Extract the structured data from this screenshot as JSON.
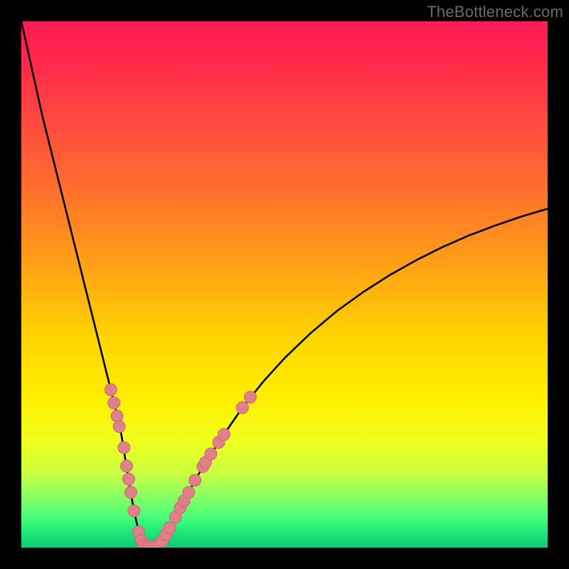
{
  "watermark": "TheBottleneck.com",
  "colors": {
    "background": "#000000",
    "watermark": "#6b6b6b",
    "curve": "#000000",
    "marker_fill": "#e08088",
    "marker_stroke": "#c86a74"
  },
  "chart_data": {
    "type": "line",
    "title": "",
    "xlabel": "",
    "ylabel": "",
    "xlim": [
      0,
      100
    ],
    "ylim": [
      0,
      100
    ],
    "grid": false,
    "legend": false,
    "series": [
      {
        "name": "bottleneck-curve",
        "x": [
          0,
          2,
          4,
          6,
          8,
          10,
          12,
          14,
          16,
          18,
          19,
          19.8,
          20.6,
          21.4,
          22.2,
          22.8,
          23.4,
          24,
          25,
          26,
          27,
          28,
          29.5,
          31,
          33,
          35,
          38,
          42,
          46,
          50,
          55,
          60,
          65,
          70,
          75,
          80,
          85,
          90,
          95,
          100
        ],
        "y": [
          100,
          91,
          82,
          74,
          66,
          58,
          50,
          42,
          34,
          26,
          21.5,
          16.5,
          11.5,
          7,
          3.5,
          1.4,
          0.4,
          0.2,
          0.2,
          0.5,
          1.5,
          3.3,
          6,
          9,
          12.8,
          16.2,
          20.8,
          26.6,
          31.6,
          36,
          40.8,
          45,
          48.6,
          51.8,
          54.6,
          57.1,
          59.3,
          61.2,
          62.9,
          64.4
        ]
      }
    ],
    "markers": [
      {
        "name": "left-points",
        "points": [
          {
            "x": 17.0,
            "y": 30.0
          },
          {
            "x": 17.6,
            "y": 27.5
          },
          {
            "x": 18.2,
            "y": 25.0
          },
          {
            "x": 18.6,
            "y": 23.0
          },
          {
            "x": 19.5,
            "y": 19.0
          },
          {
            "x": 20.0,
            "y": 15.5
          },
          {
            "x": 20.4,
            "y": 13.0
          },
          {
            "x": 20.8,
            "y": 10.5
          },
          {
            "x": 21.4,
            "y": 7.0
          },
          {
            "x": 22.3,
            "y": 3.0
          },
          {
            "x": 22.8,
            "y": 1.4
          }
        ]
      },
      {
        "name": "bottom-points",
        "points": [
          {
            "x": 23.2,
            "y": 0.6
          },
          {
            "x": 23.8,
            "y": 0.3
          },
          {
            "x": 24.4,
            "y": 0.25
          },
          {
            "x": 25.0,
            "y": 0.25
          },
          {
            "x": 25.6,
            "y": 0.3
          },
          {
            "x": 26.2,
            "y": 0.6
          }
        ]
      },
      {
        "name": "right-points",
        "points": [
          {
            "x": 26.8,
            "y": 1.3
          },
          {
            "x": 27.5,
            "y": 2.5
          },
          {
            "x": 28.2,
            "y": 3.8
          },
          {
            "x": 29.3,
            "y": 5.8
          },
          {
            "x": 30.2,
            "y": 7.6
          },
          {
            "x": 30.9,
            "y": 8.9
          },
          {
            "x": 31.8,
            "y": 10.5
          },
          {
            "x": 33.0,
            "y": 12.8
          },
          {
            "x": 34.5,
            "y": 15.4
          },
          {
            "x": 35.0,
            "y": 16.2
          },
          {
            "x": 36.0,
            "y": 17.8
          },
          {
            "x": 37.5,
            "y": 20.0
          },
          {
            "x": 38.5,
            "y": 21.5
          },
          {
            "x": 42.0,
            "y": 26.6
          },
          {
            "x": 43.5,
            "y": 28.6
          }
        ]
      }
    ]
  }
}
